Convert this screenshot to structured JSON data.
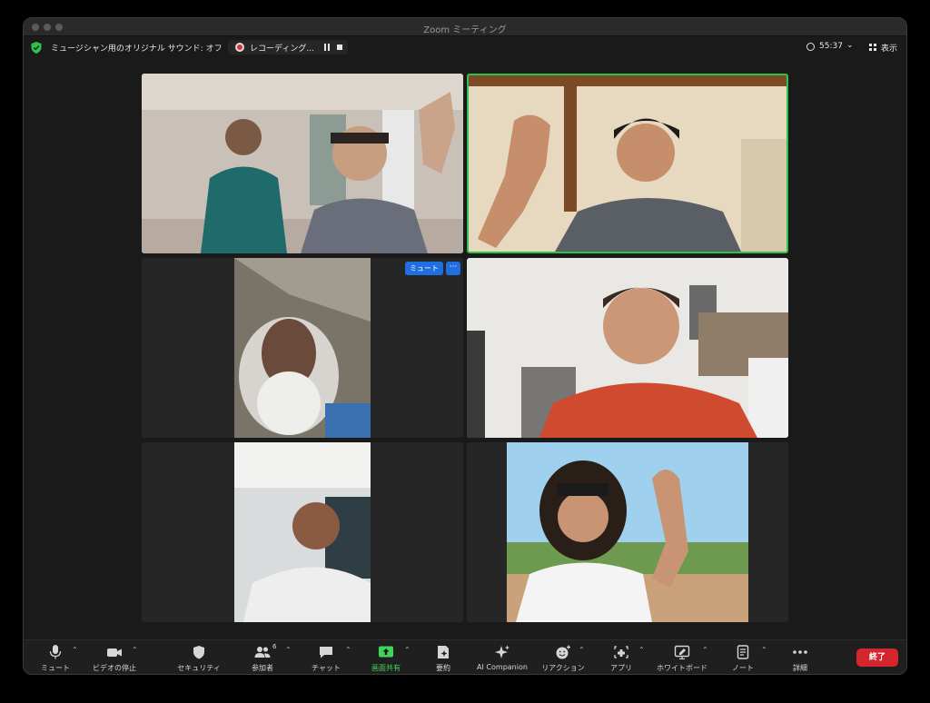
{
  "window": {
    "title": "Zoom ミーティング"
  },
  "topbar": {
    "music_label": "ミュージシャン用のオリジナル サウンド: オフ",
    "recording_label": "レコーディング...",
    "timer": "55:37",
    "view_label": "表示"
  },
  "tiles": {
    "mute_label": "ミュート",
    "more_label": "···"
  },
  "toolbar": {
    "mute": "ミュート",
    "video": "ビデオの停止",
    "security": "セキュリティ",
    "participants": "参加者",
    "participants_count": "6",
    "chat": "チャット",
    "share": "画面共有",
    "summary": "要約",
    "ai_companion": "AI Companion",
    "reactions": "リアクション",
    "apps": "アプリ",
    "whiteboard": "ホワイトボード",
    "notes": "ノート",
    "more": "詳細",
    "end": "終了"
  },
  "colors": {
    "active_speaker": "#2fc24a",
    "share_green": "#3fd45a",
    "end_red": "#d4262c",
    "mute_blue": "#1f6fe0"
  }
}
